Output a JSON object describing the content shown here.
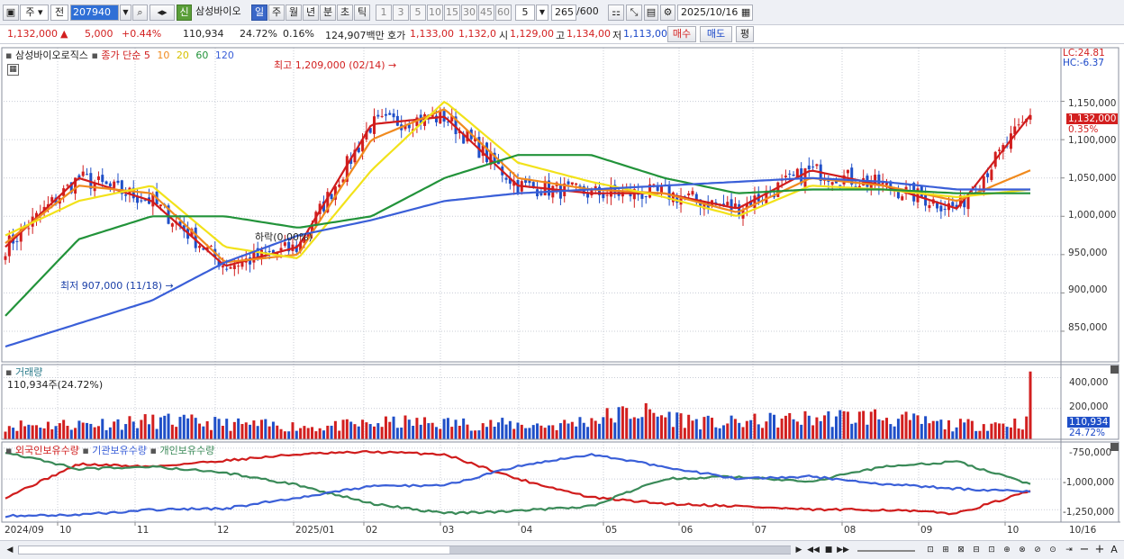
{
  "toolbar": {
    "market_sel": "주",
    "prev_btn": "전",
    "code_value": "207940",
    "special_btn": "신",
    "stock_name": "삼성바이오",
    "periods": [
      "일",
      "주",
      "월",
      "년",
      "분",
      "초",
      "틱"
    ],
    "active_period": "일",
    "intervals": [
      "1",
      "3",
      "5",
      "10",
      "15",
      "30",
      "45",
      "60"
    ],
    "interval_value": "5",
    "count_value": "265",
    "count_total": "/600",
    "date_value": "2025/10/16"
  },
  "quote": {
    "price": "1,132,000",
    "change_arrow": "▲",
    "change": "5,000",
    "change_pct": "+0.44%",
    "volume": "110,934",
    "volume_pct": "24.72%",
    "turnover_pct": "0.16%",
    "amount": "124,907백만",
    "bid_label": "호가",
    "bid_values": "1,133,00",
    "bid_values2": "1,132,0",
    "open_label": "시",
    "open": "1,129,00",
    "high_label": "고",
    "high": "1,134,00",
    "low_label": "저",
    "low": "1,113,00",
    "buy_btn": "매수",
    "sell_btn": "매도",
    "avg_btn": "평"
  },
  "price_panel": {
    "stock_label": "삼성바이오로직스",
    "ma_title": "종가 단순",
    "ma_periods": [
      "5",
      "10",
      "20",
      "60",
      "120"
    ],
    "high_anno": "최고 1,209,000 (02/14) →",
    "low_anno": "최저 907,000 (11/18) →",
    "mid_anno": "하락(0.00%)",
    "lc": "LC:24.81",
    "hc": "HC:-6.37",
    "current_price": "1,132,000",
    "current_pct": "0.35%",
    "y_ticks": [
      "1,150,000",
      "1,100,000",
      "1,050,000",
      "1,000,000",
      "950,000",
      "900,000",
      "850,000"
    ]
  },
  "volume_panel": {
    "title": "거래량",
    "value_label": "110,934주(24.72%)",
    "y_ticks": [
      "400,000",
      "200,000"
    ],
    "current": "110,934",
    "current_pct": "24.72%"
  },
  "holder_panel": {
    "legend": [
      "외국인보유수량",
      "기관보유수량",
      "개인보유수량"
    ],
    "y_ticks": [
      "-750,000",
      "-1,000,000",
      "-1,250,000"
    ]
  },
  "x_axis": {
    "labels": [
      "2024/09",
      "10",
      "11",
      "12",
      "2025/01",
      "02",
      "03",
      "04",
      "05",
      "06",
      "07",
      "08",
      "09",
      "10",
      "10/16"
    ]
  },
  "colors": {
    "up": "#d21f1f",
    "down": "#1f4fc8",
    "ma5": "#d01c1c",
    "ma10": "#f08a1e",
    "ma20": "#f2e21a",
    "ma60": "#22933a",
    "ma120": "#3a5fd8",
    "foreign": "#d01c1c",
    "institution": "#3a8a58",
    "individual": "#3a5fd8"
  },
  "chart_data": [
    {
      "type": "line",
      "title": "",
      "xlabel": "",
      "ylabel": "",
      "ylim": [
        810000,
        1220000
      ],
      "note_series": "approximate closing price and moving averages read from chart; x is month",
      "x": [
        "2024/09",
        "10",
        "11",
        "12",
        "2025/01",
        "02",
        "03",
        "04",
        "05",
        "06",
        "07",
        "08",
        "09",
        "10",
        "10/16"
      ],
      "series": [
        {
          "name": "5",
          "values": [
            960000,
            1050000,
            1020000,
            935000,
            960000,
            1120000,
            1130000,
            1040000,
            1030000,
            1030000,
            1010000,
            1060000,
            1040000,
            1010000,
            1132000
          ]
        },
        {
          "name": "10",
          "values": [
            965000,
            1040000,
            1030000,
            940000,
            950000,
            1100000,
            1140000,
            1050000,
            1035000,
            1030000,
            1005000,
            1050000,
            1040000,
            1020000,
            1060000
          ]
        },
        {
          "name": "20",
          "values": [
            975000,
            1020000,
            1040000,
            960000,
            945000,
            1060000,
            1150000,
            1070000,
            1045000,
            1025000,
            1000000,
            1040000,
            1035000,
            1025000,
            1035000
          ]
        },
        {
          "name": "60",
          "values": [
            870000,
            970000,
            1000000,
            1000000,
            985000,
            1000000,
            1050000,
            1080000,
            1080000,
            1050000,
            1030000,
            1035000,
            1035000,
            1030000,
            1030000
          ]
        },
        {
          "name": "120",
          "values": [
            830000,
            860000,
            890000,
            940000,
            975000,
            995000,
            1020000,
            1030000,
            1035000,
            1040000,
            1045000,
            1050000,
            1045000,
            1035000,
            1035000
          ]
        }
      ]
    },
    {
      "type": "bar",
      "title": "거래량",
      "ylim": [
        0,
        450000
      ],
      "categories": [
        "2024/09",
        "10",
        "11",
        "12",
        "2025/01",
        "02",
        "03",
        "04",
        "05",
        "06",
        "07",
        "08",
        "09",
        "10",
        "10/16"
      ],
      "values": [
        90000,
        100000,
        120000,
        95000,
        80000,
        110000,
        100000,
        90000,
        180000,
        100000,
        130000,
        150000,
        90000,
        110000,
        440000
      ]
    },
    {
      "type": "line",
      "title": "보유수량",
      "ylim": [
        -1350000,
        -700000
      ],
      "x": [
        "2024/09",
        "10",
        "11",
        "12",
        "2025/01",
        "02",
        "03",
        "04",
        "05",
        "06",
        "07",
        "08",
        "09",
        "10",
        "10/16"
      ],
      "series": [
        {
          "name": "외국인보유수량",
          "values": [
            -1150000,
            -880000,
            -900000,
            -850000,
            -800000,
            -780000,
            -800000,
            -1000000,
            -1150000,
            -1200000,
            -1220000,
            -1250000,
            -1250000,
            -1280000,
            -1100000
          ]
        },
        {
          "name": "기관보유수량",
          "values": [
            -780000,
            -920000,
            -900000,
            -950000,
            -1050000,
            -1200000,
            -1280000,
            -1260000,
            -1220000,
            -1000000,
            -980000,
            -1020000,
            -900000,
            -860000,
            -1040000
          ]
        },
        {
          "name": "개인보유수량",
          "values": [
            -1300000,
            -1290000,
            -1250000,
            -1240000,
            -1150000,
            -1060000,
            -1050000,
            -900000,
            -800000,
            -900000,
            -1000000,
            -980000,
            -1040000,
            -1080000,
            -1100000
          ]
        }
      ]
    }
  ]
}
